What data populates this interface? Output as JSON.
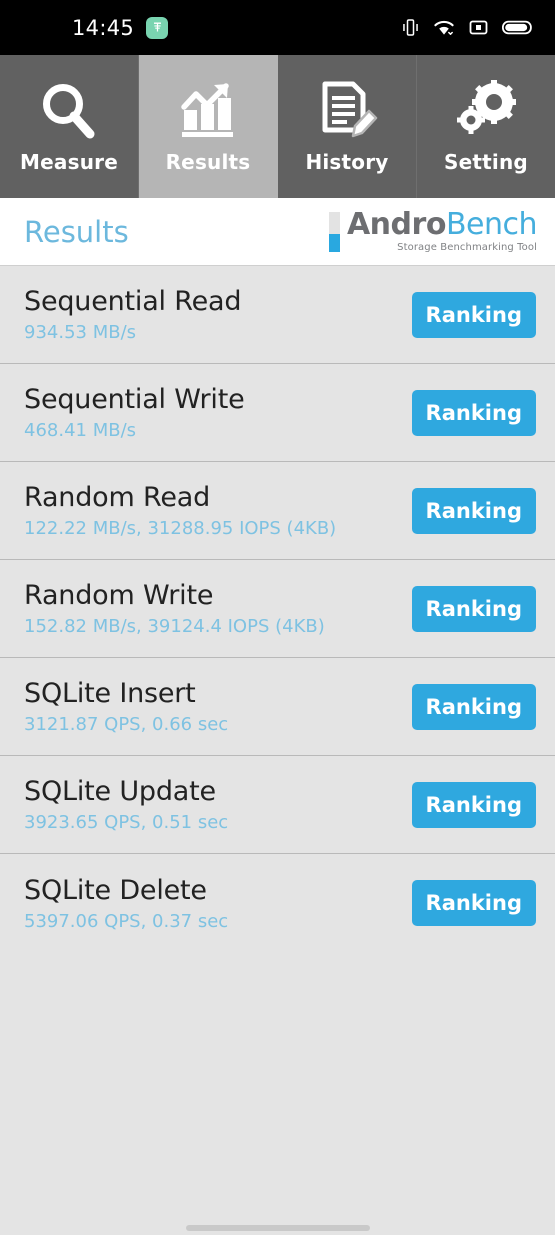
{
  "statusbar": {
    "time": "14:45",
    "app_icon": "app-icon",
    "icons": [
      "vibrate-icon",
      "wifi-icon",
      "screen-record-icon",
      "battery-icon"
    ]
  },
  "tabs": [
    {
      "label": "Measure",
      "icon": "magnifier-icon",
      "active": false
    },
    {
      "label": "Results",
      "icon": "bar-chart-arrow-icon",
      "active": true
    },
    {
      "label": "History",
      "icon": "document-pencil-icon",
      "active": false
    },
    {
      "label": "Setting",
      "icon": "gears-icon",
      "active": false
    }
  ],
  "header": {
    "title": "Results",
    "logo": {
      "word1": "Andro",
      "word2": "Bench",
      "tagline": "Storage Benchmarking Tool",
      "accent_gray": "#E3E3E3",
      "accent_blue": "#29A8E0"
    }
  },
  "colors": {
    "title_blue": "#6CB8DD",
    "value_blue": "#7EC2E2",
    "button_blue": "#2FA8DF",
    "list_bg": "#E4E4E4",
    "tab_inactive": "#616161",
    "tab_active": "#B5B5B5"
  },
  "results": {
    "button_label": "Ranking",
    "rows": [
      {
        "title": "Sequential Read",
        "value": "934.53 MB/s"
      },
      {
        "title": "Sequential Write",
        "value": "468.41 MB/s"
      },
      {
        "title": "Random Read",
        "value": "122.22 MB/s, 31288.95 IOPS (4KB)"
      },
      {
        "title": "Random Write",
        "value": "152.82 MB/s, 39124.4 IOPS (4KB)"
      },
      {
        "title": "SQLite Insert",
        "value": "3121.87 QPS, 0.66 sec"
      },
      {
        "title": "SQLite Update",
        "value": "3923.65 QPS, 0.51 sec"
      },
      {
        "title": "SQLite Delete",
        "value": "5397.06 QPS, 0.37 sec"
      }
    ]
  },
  "navigation": {
    "gesture_bar": "home-indicator"
  }
}
